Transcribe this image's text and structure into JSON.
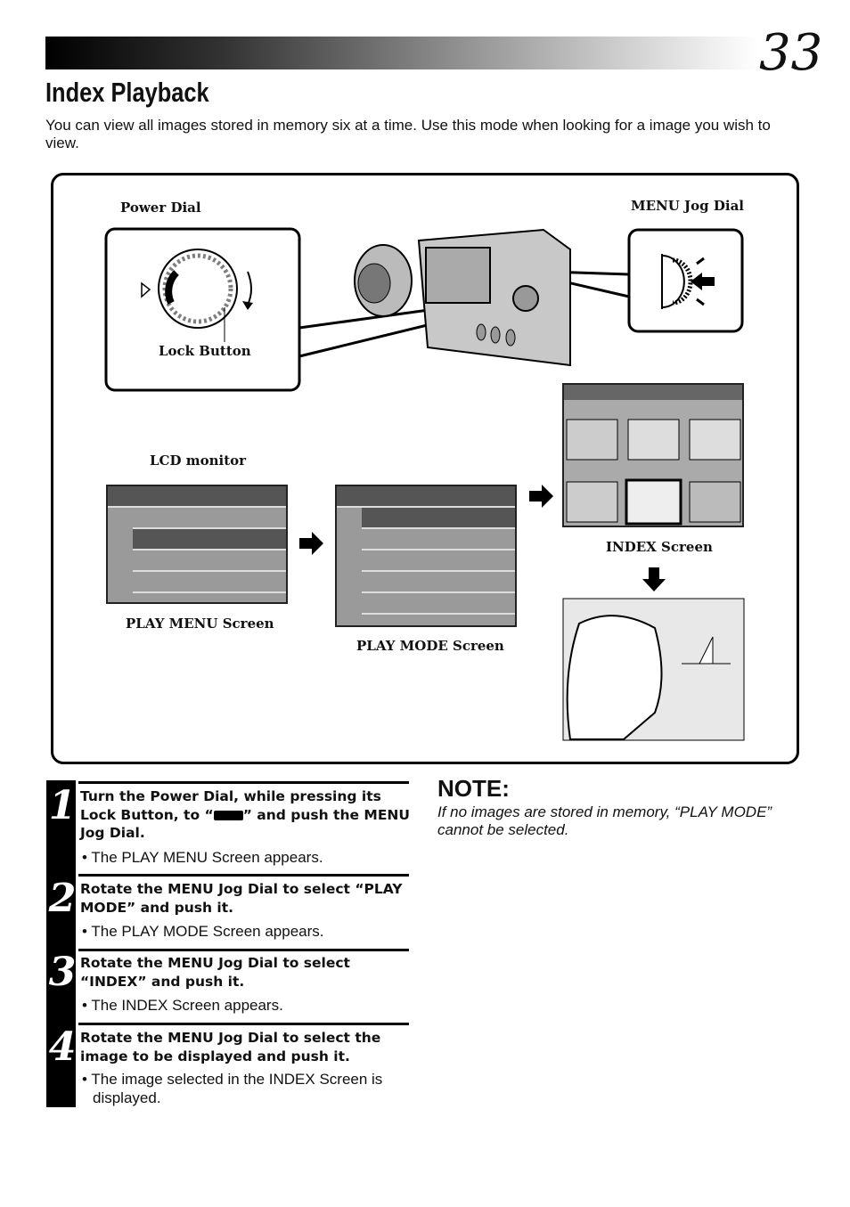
{
  "header": {
    "page_number": "33",
    "title": "Index Playback",
    "intro": "You can view all images stored in memory six at a time. Use this mode when looking for a image you wish to view."
  },
  "diagram": {
    "labels": {
      "power_dial": "Power Dial",
      "menu_jog_dial": "MENU Jog Dial",
      "lock_button": "Lock Button",
      "lcd_monitor": "LCD monitor",
      "play_menu_screen": "PLAY MENU Screen",
      "play_mode_screen": "PLAY MODE Screen",
      "index_screen": "INDEX Screen"
    },
    "play_menu_selected_row": 2,
    "play_mode_selected_row": 1
  },
  "steps": [
    {
      "number": "1",
      "head_pre": "Turn the Power Dial, while pressing its Lock Button, to “",
      "head_post": "” and push the MENU Jog Dial.",
      "result": "The PLAY MENU Screen appears."
    },
    {
      "number": "2",
      "head": "Rotate the MENU Jog Dial to select “PLAY MODE” and push it.",
      "result": "The PLAY MODE Screen appears."
    },
    {
      "number": "3",
      "head": "Rotate the MENU Jog Dial to select “INDEX” and push it.",
      "result": "The INDEX Screen appears."
    },
    {
      "number": "4",
      "head": "Rotate the MENU Jog Dial to select the image to be displayed and push it.",
      "result": "The image selected in the INDEX Screen is displayed."
    }
  ],
  "note": {
    "heading": "NOTE:",
    "text": "If no images are stored in memory, “PLAY MODE” cannot be selected."
  }
}
